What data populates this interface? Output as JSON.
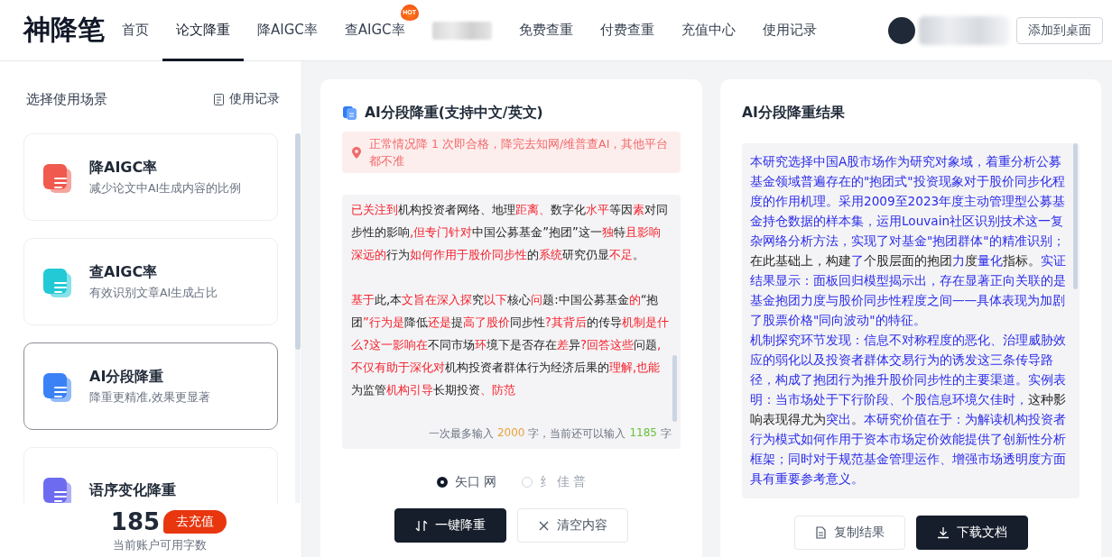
{
  "brand": "神降笔",
  "nav": [
    {
      "label": "首页",
      "selected": false
    },
    {
      "label": "论文降重",
      "selected": true
    },
    {
      "label": "降AIGC率",
      "selected": false
    },
    {
      "label": "查AIGC率",
      "selected": false,
      "badge": "HOT"
    },
    {
      "kind": "blurred",
      "selected": false
    },
    {
      "label": "免费查重",
      "selected": false
    },
    {
      "label": "付费查重",
      "selected": false
    },
    {
      "label": "充值中心",
      "selected": false
    },
    {
      "label": "使用记录",
      "selected": false
    }
  ],
  "user": {
    "kind": "blurred"
  },
  "add_to_desktop": "添加到桌面",
  "sidebar": {
    "title": "选择使用场景",
    "history_link": "使用记录",
    "items": [
      {
        "title": "降AIGC率",
        "desc": "减少论文中AI生成内容的比例",
        "color": "#f05a4f",
        "selected": false
      },
      {
        "title": "查AIGC率",
        "desc": "有效识别文章AI生成占比",
        "color": "#22c9d6",
        "selected": false
      },
      {
        "title": "AI分段降重",
        "desc": "降重更精准,效果更显著",
        "color": "#3b82f6",
        "selected": true
      },
      {
        "title": "语序变化降重",
        "color": "#6d6cf0",
        "selected": false
      }
    ],
    "balance": "185",
    "recharge": "去充值",
    "balance_label": "当前账户可用字数"
  },
  "input_card": {
    "title": "AI分段降重(支持中文/英文)",
    "notice": "正常情况降 1 次即合格，降完去知网/维普查AI，其他平台都不准",
    "paragraphs": [
      [
        {
          "t": "已关注到",
          "changed": true
        },
        {
          "t": "机构投资者网络、地理",
          "changed": false
        },
        {
          "t": "距离、",
          "changed": true
        },
        {
          "t": "数字化",
          "changed": false
        },
        {
          "t": "水平",
          "changed": true
        },
        {
          "t": "等因",
          "changed": false
        },
        {
          "t": "素",
          "changed": true
        },
        {
          "t": "对同步性的影响",
          "changed": false
        },
        {
          "t": ",但专门针对",
          "changed": true
        },
        {
          "t": "中国公募基金”抱团”这一",
          "changed": false
        },
        {
          "t": "独",
          "changed": true
        },
        {
          "t": "特",
          "changed": false
        },
        {
          "t": "且影响深远的",
          "changed": true
        },
        {
          "t": "行为",
          "changed": false
        },
        {
          "t": "如何作用于股价同步性",
          "changed": true
        },
        {
          "t": "的",
          "changed": false
        },
        {
          "t": "系统",
          "changed": true
        },
        {
          "t": "研究仍显",
          "changed": false
        },
        {
          "t": "不足",
          "changed": true
        },
        {
          "t": "。",
          "changed": false
        }
      ],
      [
        {
          "t": "基于",
          "changed": true
        },
        {
          "t": "此,本",
          "changed": false
        },
        {
          "t": "文旨在深入探",
          "changed": true
        },
        {
          "t": "究",
          "changed": false
        },
        {
          "t": "以下",
          "changed": true
        },
        {
          "t": "核心",
          "changed": false
        },
        {
          "t": "问",
          "changed": true
        },
        {
          "t": "题:中国公募基金",
          "changed": false
        },
        {
          "t": "的",
          "changed": true
        },
        {
          "t": "“抱团",
          "changed": false
        },
        {
          "t": "”行为是",
          "changed": true
        },
        {
          "t": "降低",
          "changed": false
        },
        {
          "t": "还是",
          "changed": true
        },
        {
          "t": "提",
          "changed": false
        },
        {
          "t": "高了股价",
          "changed": true
        },
        {
          "t": "同步性",
          "changed": false
        },
        {
          "t": "?其背后",
          "changed": true
        },
        {
          "t": "的传导",
          "changed": false
        },
        {
          "t": "机制是什么?这一影响在",
          "changed": true
        },
        {
          "t": "不同市场",
          "changed": false
        },
        {
          "t": "环",
          "changed": true
        },
        {
          "t": "境下是否存在",
          "changed": false
        },
        {
          "t": "差",
          "changed": true
        },
        {
          "t": "异",
          "changed": false
        },
        {
          "t": "?回答这些",
          "changed": true
        },
        {
          "t": "问题",
          "changed": false
        },
        {
          "t": ",不仅有助于深化对",
          "changed": true
        },
        {
          "t": "机构投资者群体行为经济后果的",
          "changed": false
        },
        {
          "t": "理解,也能",
          "changed": true
        },
        {
          "t": "为监管",
          "changed": false
        },
        {
          "t": "机构引导",
          "changed": true
        },
        {
          "t": "长期投资",
          "changed": false
        },
        {
          "t": "、防范",
          "changed": true
        }
      ]
    ],
    "counter": {
      "prefix": "一次最多输入",
      "max": "2000",
      "middle": "字，当前还可以输入",
      "remaining": "1185",
      "suffix": "字"
    },
    "options": [
      {
        "label": "矢口 网",
        "selected": true
      },
      {
        "label": "纟 佳 普",
        "selected": false
      }
    ],
    "buttons": [
      {
        "label": "一键降重",
        "kind": "primary"
      },
      {
        "label": "清空内容",
        "kind": "secondary"
      }
    ]
  },
  "result_card": {
    "title": "AI分段降重结果",
    "paragraphs": [
      [
        {
          "t": "本研究选择中国A股市场作为研究对象域，着重分析公募基金领域普遍存在的\"抱团式\"投资现象对于股价同步化程度的作用机理。采用2009至2023年度主动管理型公募基金持仓数据的样本集，运用Louvain社区识别技术这一复杂网络分析方法，实现了对基金\"抱团群体\"的精准识别；",
          "changed": true
        },
        {
          "t": "在此基础上，构建",
          "changed": false
        },
        {
          "t": "了",
          "changed": true
        },
        {
          "t": "个股层面的抱团",
          "changed": false
        },
        {
          "t": "力",
          "changed": true
        },
        {
          "t": "度",
          "changed": false
        },
        {
          "t": "量化",
          "changed": true
        },
        {
          "t": "指标。",
          "changed": false
        },
        {
          "t": "实证结果显示：面板回归模型揭示出，存在显著正向关联的是基金抱团力度与股价同步性程度之间——具体表现为加剧了股票价格\"同向波动\"的特征。",
          "changed": true
        }
      ],
      [
        {
          "t": "机制探究环节发现：信息不对称程度的恶化、治理威胁效应的弱化以及投资者群体交易行为的诱发这三条传导路径，构成了抱团行为推升股价同步性的主要渠道。实例表明：当市场处于下行阶段、个股信息环境欠佳时，",
          "changed": true
        },
        {
          "t": "这种影响表现得尤为",
          "changed": false
        },
        {
          "t": "突出",
          "changed": true
        },
        {
          "t": "。",
          "changed": false
        },
        {
          "t": "本研究价值在于：为解读机构投资者行为模式如何作用于资本市场定价效能提供了创新性分析框架；同时对于规范基金管理运作、增强市场透明度方面具有重要参考意义。",
          "changed": true
        }
      ]
    ],
    "buttons": [
      {
        "label": "复制结果",
        "kind": "secondary"
      },
      {
        "label": "下载文档",
        "kind": "primary"
      }
    ]
  }
}
